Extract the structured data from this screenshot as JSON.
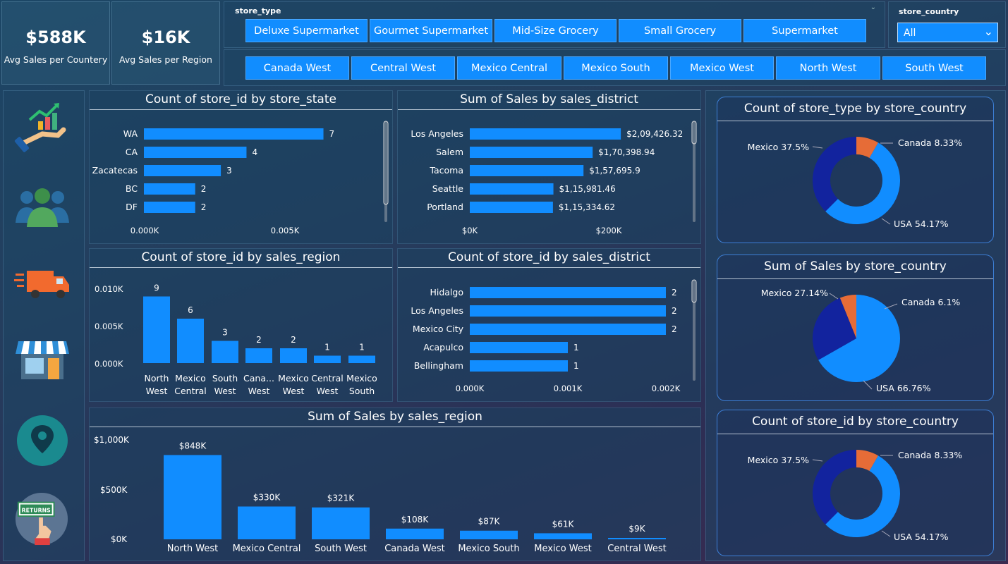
{
  "kpis": [
    {
      "value": "$588K",
      "label": "Avg Sales per Countery"
    },
    {
      "value": "$16K",
      "label": "Avg Sales per Region"
    }
  ],
  "slicers": {
    "store_type_label": "store_type",
    "store_types": [
      "Deluxe Supermarket",
      "Gourmet Supermarket",
      "Mid-Size Grocery",
      "Small Grocery",
      "Supermarket"
    ],
    "regions": [
      "Canada West",
      "Central West",
      "Mexico Central",
      "Mexico South",
      "Mexico West",
      "North West",
      "South West"
    ],
    "store_country_label": "store_country",
    "store_country_value": "All"
  },
  "colors": {
    "bar": "#118dff",
    "mexico": "#12239e",
    "canada": "#e66c37",
    "usa": "#118dff"
  },
  "icons": [
    "growth-hand-icon",
    "team-icon",
    "delivery-truck-icon",
    "store-icon",
    "location-pin-icon",
    "returns-sign-icon"
  ],
  "chart_data": [
    {
      "id": "state",
      "type": "bar",
      "orientation": "horizontal",
      "title": "Count of store_id by store_state",
      "categories": [
        "WA",
        "CA",
        "Zacatecas",
        "BC",
        "DF"
      ],
      "values": [
        7,
        4,
        3,
        2,
        2
      ],
      "value_labels": [
        "7",
        "4",
        "3",
        "2",
        "2"
      ],
      "xticks": [
        "0.000K",
        "0.005K"
      ],
      "xlim": [
        0,
        8.8
      ]
    },
    {
      "id": "salesdistrict",
      "type": "bar",
      "orientation": "horizontal",
      "title": "Sum of Sales by sales_district",
      "categories": [
        "Los Angeles",
        "Salem",
        "Tacoma",
        "Seattle",
        "Portland"
      ],
      "values": [
        209426.32,
        170398.94,
        157695.9,
        115981.46,
        115334.62
      ],
      "value_labels": [
        "$2,09,426.32",
        "$1,70,398.94",
        "$1,57,695.9",
        "$1,15,981.46",
        "$1,15,334.62"
      ],
      "xticks": [
        "$0K",
        "$200K"
      ],
      "xlim": [
        0,
        270000
      ]
    },
    {
      "id": "region",
      "type": "bar",
      "orientation": "vertical",
      "title": "Count of store_id by sales_region",
      "categories": [
        "North West",
        "Mexico Central",
        "South West",
        "Cana... West",
        "Mexico West",
        "Central West",
        "Mexico South"
      ],
      "values": [
        9,
        6,
        3,
        2,
        2,
        1,
        1
      ],
      "value_labels": [
        "9",
        "6",
        "3",
        "2",
        "2",
        "1",
        "1"
      ],
      "yticks": [
        "0.010K",
        "0.005K",
        "0.000K"
      ],
      "ylim": [
        0,
        10
      ]
    },
    {
      "id": "countdistrict",
      "type": "bar",
      "orientation": "horizontal",
      "title": "Count of store_id by sales_district",
      "categories": [
        "Hidalgo",
        "Los Angeles",
        "Mexico City",
        "Acapulco",
        "Bellingham"
      ],
      "values": [
        2,
        2,
        2,
        1,
        1
      ],
      "value_labels": [
        "2",
        "2",
        "2",
        "1",
        "1"
      ],
      "xticks": [
        "0.000K",
        "0.001K",
        "0.002K"
      ],
      "xlim": [
        0,
        2
      ]
    },
    {
      "id": "salesregion",
      "type": "bar",
      "orientation": "vertical",
      "title": "Sum of Sales by sales_region",
      "categories": [
        "North West",
        "Mexico Central",
        "South West",
        "Canada West",
        "Mexico South",
        "Mexico West",
        "Central West"
      ],
      "values": [
        848,
        330,
        321,
        108,
        87,
        61,
        9
      ],
      "value_labels": [
        "$848K",
        "$330K",
        "$321K",
        "$108K",
        "$87K",
        "$61K",
        "$9K"
      ],
      "yticks": [
        "$1,000K",
        "$500K",
        "$0K"
      ],
      "ylim": [
        0,
        1000
      ]
    },
    {
      "id": "pie1",
      "type": "pie",
      "donut": true,
      "title": "Count of store_type by store_country",
      "slices": [
        {
          "name": "USA",
          "value": 54.17,
          "label": "USA 54.17%"
        },
        {
          "name": "Mexico",
          "value": 37.5,
          "label": "Mexico 37.5%"
        },
        {
          "name": "Canada",
          "value": 8.33,
          "label": "Canada 8.33%"
        }
      ]
    },
    {
      "id": "pie2",
      "type": "pie",
      "donut": false,
      "title": "Sum of Sales by store_country",
      "slices": [
        {
          "name": "USA",
          "value": 66.76,
          "label": "USA 66.76%"
        },
        {
          "name": "Mexico",
          "value": 27.14,
          "label": "Mexico 27.14%"
        },
        {
          "name": "Canada",
          "value": 6.1,
          "label": "Canada 6.1%"
        }
      ]
    },
    {
      "id": "pie3",
      "type": "pie",
      "donut": true,
      "title": "Count of store_id by store_country",
      "slices": [
        {
          "name": "USA",
          "value": 54.17,
          "label": "USA 54.17%"
        },
        {
          "name": "Mexico",
          "value": 37.5,
          "label": "Mexico 37.5%"
        },
        {
          "name": "Canada",
          "value": 8.33,
          "label": "Canada 8.33%"
        }
      ]
    }
  ]
}
